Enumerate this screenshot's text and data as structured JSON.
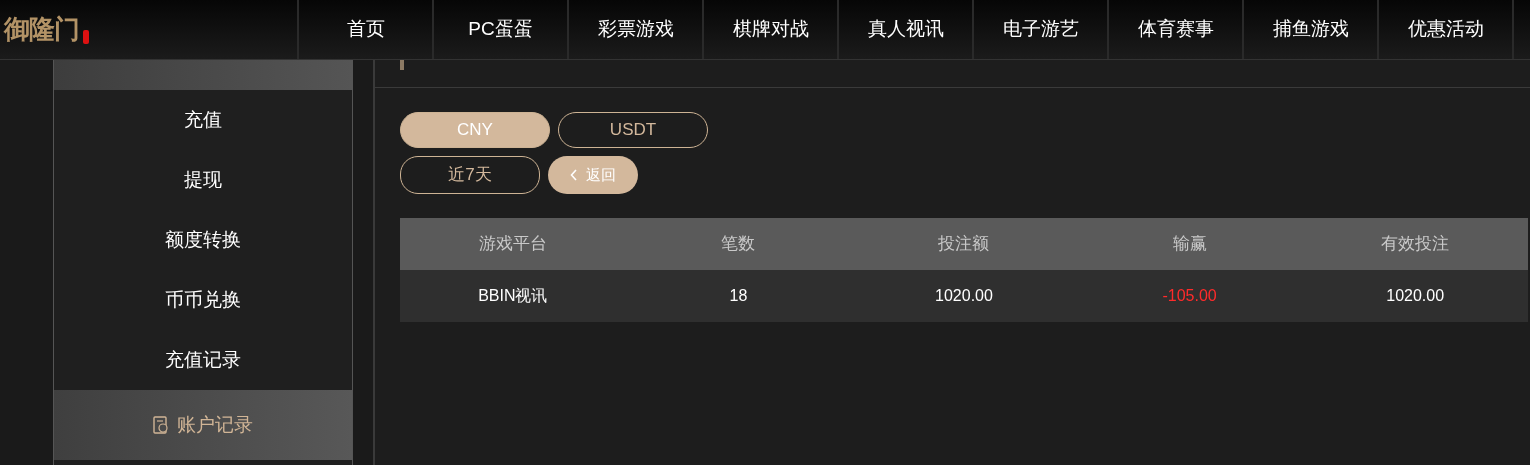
{
  "logo": {
    "text": "御隆门"
  },
  "nav": [
    "首页",
    "PC蛋蛋",
    "彩票游戏",
    "棋牌对战",
    "真人视讯",
    "电子游艺",
    "体育赛事",
    "捕鱼游戏",
    "优惠活动"
  ],
  "sidebar": {
    "items": [
      {
        "label": "充值",
        "selected": false
      },
      {
        "label": "提现",
        "selected": false
      },
      {
        "label": "额度转换",
        "selected": false
      },
      {
        "label": "币币兑换",
        "selected": false
      },
      {
        "label": "充值记录",
        "selected": false
      },
      {
        "label": "账户记录",
        "selected": true
      }
    ]
  },
  "currencies": [
    {
      "label": "CNY",
      "selected": true
    },
    {
      "label": "USDT",
      "selected": false
    }
  ],
  "period": {
    "label": "近7天"
  },
  "back_button": {
    "label": "返回"
  },
  "table": {
    "columns": [
      "游戏平台",
      "笔数",
      "投注额",
      "输赢",
      "有效投注"
    ],
    "rows": [
      {
        "platform": "BBIN视讯",
        "count": "18",
        "bet": "1020.00",
        "win": "-105.00",
        "win_negative": true,
        "valid": "1020.00"
      }
    ]
  }
}
